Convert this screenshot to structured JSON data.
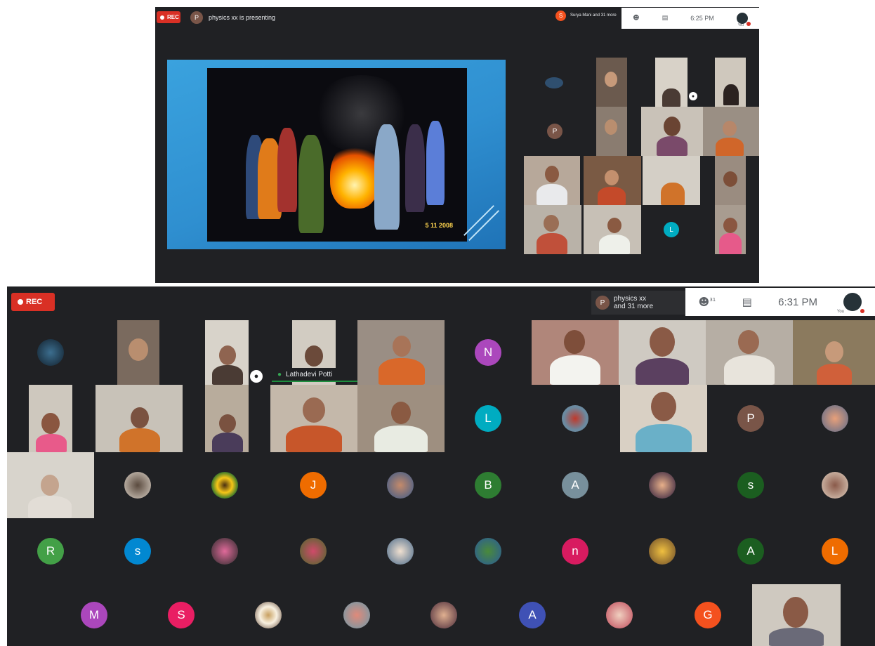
{
  "screenshot_1": {
    "rec_label": "REC",
    "presenter_initial": "P",
    "presenting_text": "physics xx is presenting",
    "speaker_initial": "S",
    "speaker_text": "Surya Mani and 31 more",
    "clock": "6:25 PM",
    "you_label": "You",
    "slide_photo_date": "5 11 2008",
    "tile_initials": [
      "P",
      "L"
    ]
  },
  "screenshot_2": {
    "rec_label": "REC",
    "speaker_initial": "P",
    "speaker_name": "physics xx",
    "speaker_more": "and 31 more",
    "people_count": "31",
    "clock": "6:31 PM",
    "you_label": "You",
    "name_tag": "Lathadevi Potti",
    "participant_initials": [
      "N",
      "L",
      "P",
      "J",
      "B",
      "A",
      "s",
      "R",
      "s",
      "n",
      "A",
      "L",
      "M",
      "S",
      "A",
      "G"
    ]
  },
  "colors": {
    "meet_dark": "#202124",
    "rec_red": "#d93025",
    "slide_blue": "#2f8fd0",
    "toolbar_white": "#ffffff"
  },
  "icons": [
    "record-dot-icon",
    "people-icon",
    "chat-icon",
    "pin-icon",
    "mic-icon"
  ]
}
